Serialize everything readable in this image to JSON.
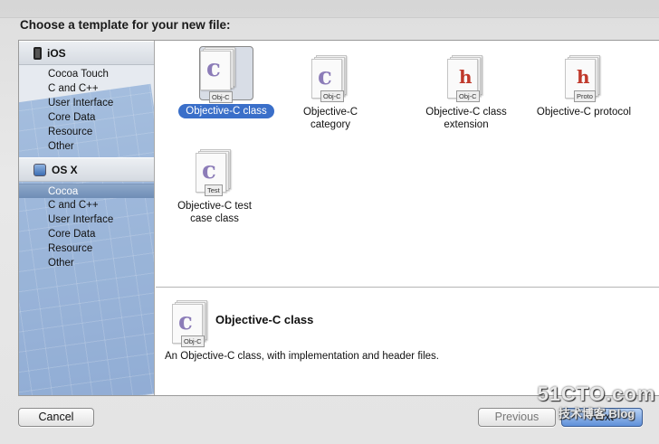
{
  "sheet": {
    "title": "Choose a template for your new file:"
  },
  "sidebar": {
    "sections": [
      {
        "name": "iOS",
        "icon": "iphone-icon",
        "items": [
          "Cocoa Touch",
          "C and C++",
          "User Interface",
          "Core Data",
          "Resource",
          "Other"
        ]
      },
      {
        "name": "OS X",
        "icon": "mac-icon",
        "items": [
          "Cocoa",
          "C and C++",
          "User Interface",
          "Core Data",
          "Resource",
          "Other"
        ],
        "selected": "Cocoa"
      }
    ]
  },
  "templates": [
    {
      "label": "Objective-C class",
      "icon": "objc-class-file-icon",
      "tag": "Obj-C",
      "letter": "c",
      "selected": true
    },
    {
      "label": "Objective-C category",
      "icon": "objc-category-file-icon",
      "tag": "Obj-C",
      "letter": "c"
    },
    {
      "label": "Objective-C class extension",
      "icon": "objc-extension-file-icon",
      "tag": "Obj-C",
      "letter": "h"
    },
    {
      "label": "Objective-C protocol",
      "icon": "objc-protocol-file-icon",
      "tag": "Proto",
      "letter": "h"
    },
    {
      "label": "Objective-C test case class",
      "icon": "objc-test-file-icon",
      "tag": "Test",
      "letter": "c"
    }
  ],
  "detail": {
    "title": "Objective-C class",
    "description": "An Objective-C class, with implementation and header files.",
    "tag": "Obj-C",
    "letter": "c"
  },
  "buttons": {
    "cancel": "Cancel",
    "previous": "Previous",
    "next": "Next"
  },
  "watermark": {
    "line1": "51CTO.com",
    "line2": "技术博客 Blog"
  }
}
